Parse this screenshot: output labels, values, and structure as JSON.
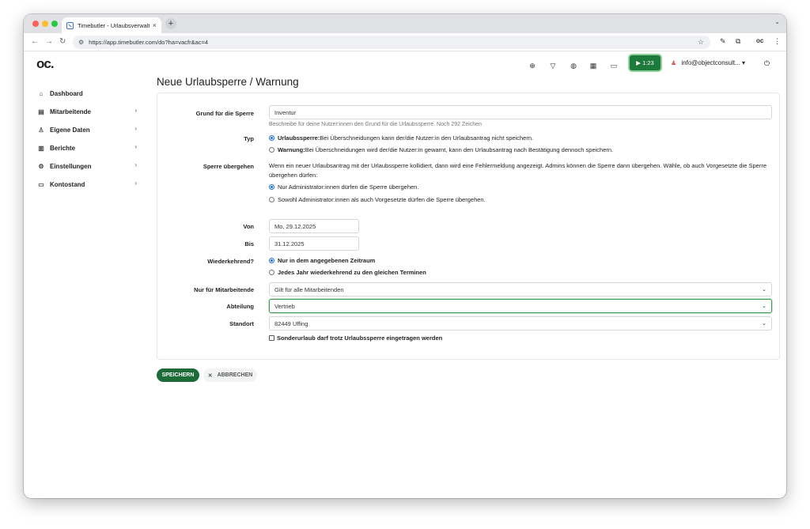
{
  "browser": {
    "tab_title": "Timebutler - Urlaubsverwaltu",
    "tab_close": "×",
    "new_tab": "+",
    "url": "https://app.timebutler.com/do?ha=vacfr&ac=4"
  },
  "app": {
    "logo": "oc.",
    "timer": "▶ 1:23",
    "user": "info@objectconsult...",
    "user_caret": "▾"
  },
  "sidebar": {
    "items": [
      {
        "label": "Dashboard",
        "icon": "home-icon",
        "glyph": "⌂",
        "has_chevron": false
      },
      {
        "label": "Mitarbeitende",
        "icon": "list-icon",
        "glyph": "▤",
        "has_chevron": true
      },
      {
        "label": "Eigene Daten",
        "icon": "person-icon",
        "glyph": "♙",
        "has_chevron": true
      },
      {
        "label": "Berichte",
        "icon": "chart-icon",
        "glyph": "▥",
        "has_chevron": true
      },
      {
        "label": "Einstellungen",
        "icon": "gear-icon",
        "glyph": "⚙",
        "has_chevron": true
      },
      {
        "label": "Kontostand",
        "icon": "wallet-icon",
        "glyph": "▭",
        "has_chevron": true
      }
    ],
    "chevron": "›"
  },
  "page": {
    "title": "Neue Urlaubsperre / Warnung"
  },
  "form": {
    "grund_label": "Grund für die Sperre",
    "grund_value": "Inventur",
    "grund_help": "Beschreibe für deine Nutzer:innen den Grund für die Urlaubssperre. Noch 292 Zeichen",
    "typ_label": "Typ",
    "typ_option1_bold": "Urlaubssperre:",
    "typ_option1_text": " Bei Überschneidungen kann der/die Nutzer:in den Urlaubsantrag nicht speichern.",
    "typ_option2_bold": "Warnung:",
    "typ_option2_text": " Bei Überschneidungen wird der/die Nutzer:in gewarnt, kann den Urlaubsantrag nach Bestätigung dennoch speichern.",
    "uebergehen_label": "Sperre übergehen",
    "uebergehen_text": "Wenn ein neuer Urlaubsantrag mit der Urlaubssperre kollidiert, dann wird eine Fehlermeldung angezeigt. Admins können die Sperre dann übergehen. Wähle, ob auch Vorgesetzte die Sperre übergehen dürfen:",
    "uebergehen_option1": "Nur Administrator:innen dürfen die Sperre übergehen.",
    "uebergehen_option2": "Sowohl Administrator:innen als auch Vorgesetzte dürfen die Sperre übergehen.",
    "von_label": "Von",
    "von_value": "Mo, 29.12.2025",
    "bis_label": "Bis",
    "bis_value": "31.12.2025",
    "wiederkehrend_label": "Wiederkehrend?",
    "wiederkehrend_option1": "Nur in dem angegebenen Zeitraum",
    "wiederkehrend_option2": "Jedes Jahr wiederkehrend zu den gleichen Terminen",
    "mitarbeitende_label": "Nur für Mitarbeitende",
    "mitarbeitende_value": "Gilt für alle Mitarbeitenden",
    "abteilung_label": "Abteilung",
    "abteilung_value": "Vertrieb",
    "standort_label": "Standort",
    "standort_value": "82449 Uffing",
    "sonderurlaub_label": "Sonderurlaub darf trotz Urlaubssperre eingetragen werden",
    "select_caret": "⌄"
  },
  "actions": {
    "save": "SPEICHERN",
    "cancel": "ABBRECHEN"
  }
}
